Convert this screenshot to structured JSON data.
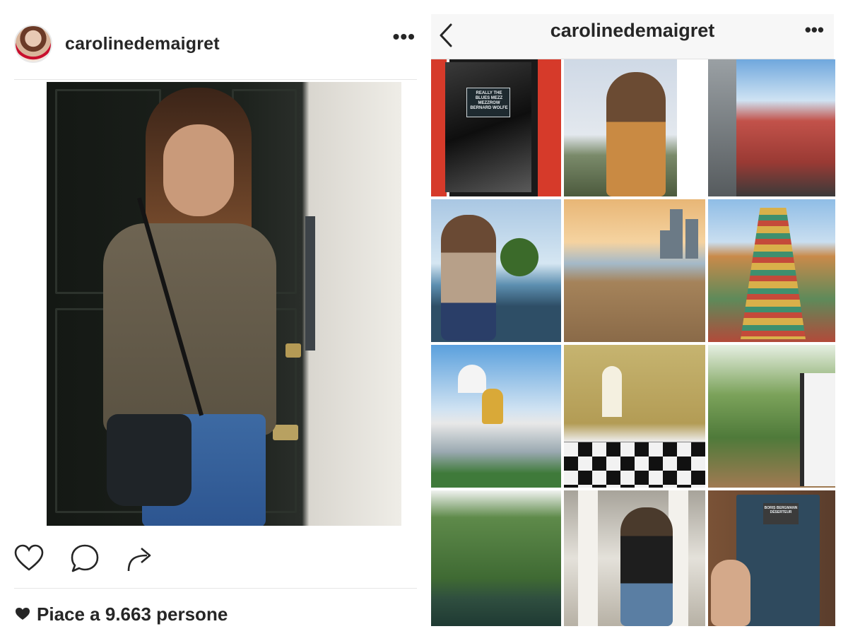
{
  "post": {
    "username": "carolinedemaigret",
    "more_label": "•••",
    "likes_text": "Piace a 9.663 persone",
    "icons": [
      "heart-icon",
      "comment-icon",
      "share-icon"
    ]
  },
  "profile": {
    "title": "carolinedemaigret",
    "more_label": "•••",
    "back_icon": "chevron-left-icon",
    "grid": [
      {
        "caption": "REALLY THE BLUES MEZZ MEZZROW BERNARD WOLFE"
      },
      {
        "caption": ""
      },
      {
        "caption": ""
      },
      {
        "caption": ""
      },
      {
        "caption": ""
      },
      {
        "caption": ""
      },
      {
        "caption": ""
      },
      {
        "caption": ""
      },
      {
        "caption": ""
      },
      {
        "caption": ""
      },
      {
        "caption": ""
      },
      {
        "caption": "BORIS BERGMANN DÉSERTEUR"
      }
    ]
  },
  "colors": {
    "text": "#262626",
    "divider": "#e6e6e6",
    "topbar_bg": "#f7f7f7"
  }
}
